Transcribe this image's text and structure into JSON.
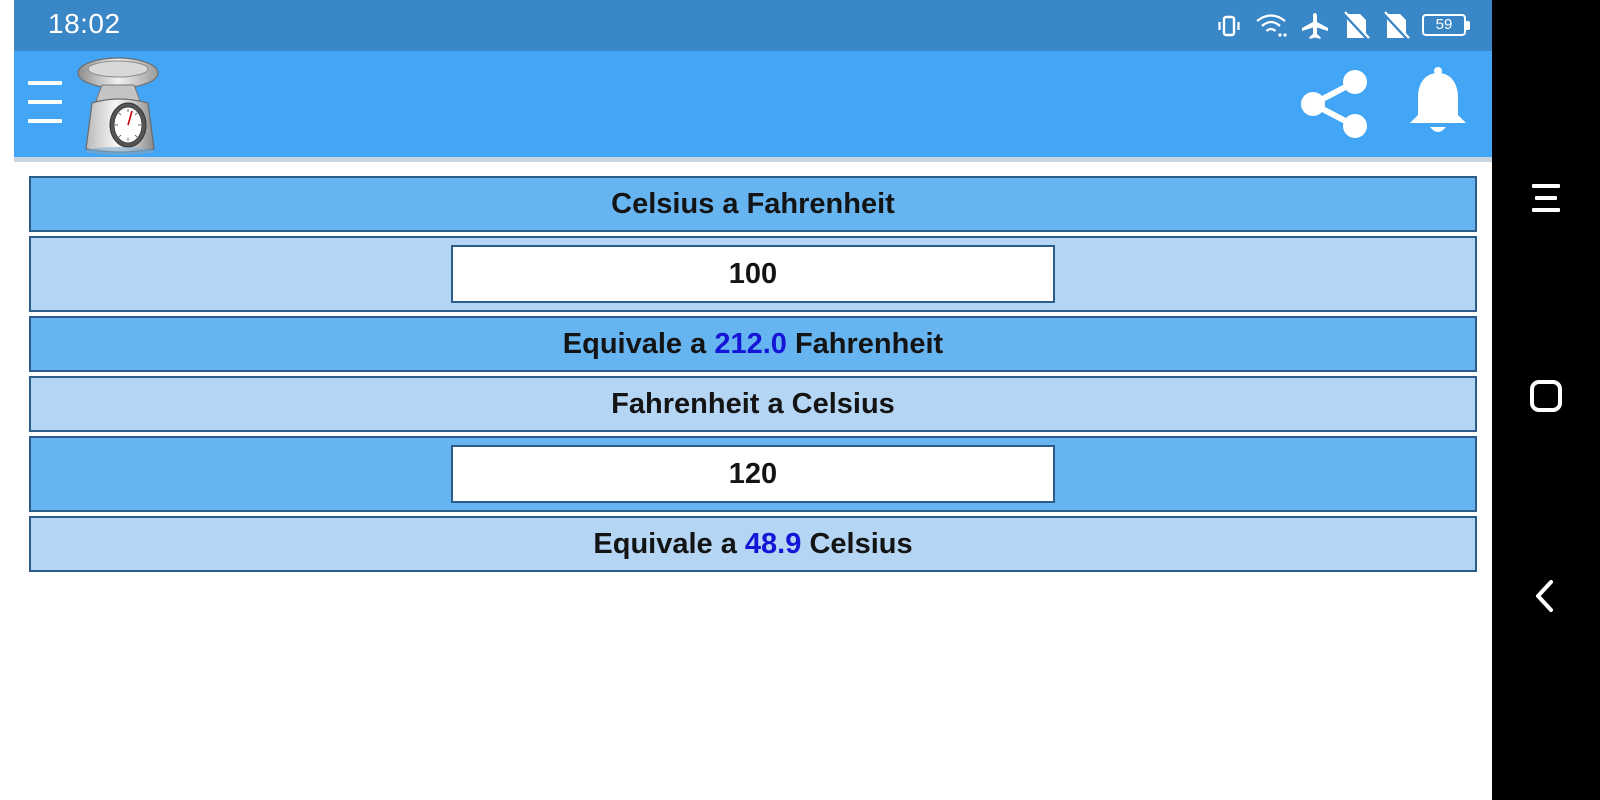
{
  "status_bar": {
    "time": "18:02",
    "battery_level": "59",
    "icons": [
      "vibrate-icon",
      "wifi-icon",
      "airplane-mode-icon",
      "no-sim-icon",
      "no-sim-icon",
      "battery-icon"
    ]
  },
  "app_bar": {
    "background": "#42a5f5",
    "icons": [
      "menu-icon",
      "kitchen-scale-logo",
      "share-icon",
      "bell-icon"
    ]
  },
  "converter": {
    "celsius_to_fahrenheit": {
      "title": "Celsius a Fahrenheit",
      "input_value": "100",
      "result_prefix": "Equivale a",
      "result_value": "212.0",
      "result_unit": "Fahrenheit"
    },
    "fahrenheit_to_celsius": {
      "title": "Fahrenheit a Celsius",
      "input_value": "120",
      "result_prefix": "Equivale a",
      "result_value": "48.9",
      "result_unit": "Celsius"
    },
    "colors": {
      "row_dark": "#66b5f1",
      "row_light": "#b4d5f3",
      "result_value": "#1515d8"
    }
  },
  "nav_bar": {
    "buttons": [
      "recents-icon",
      "home-icon",
      "back-icon"
    ]
  }
}
